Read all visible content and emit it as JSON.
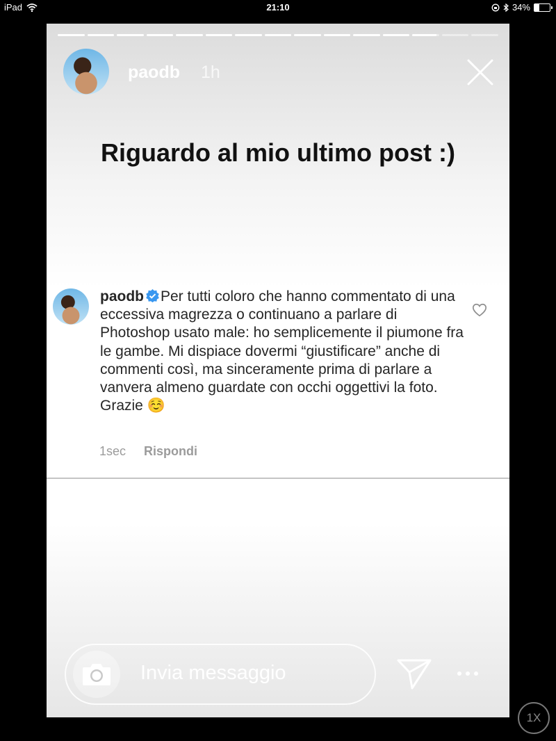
{
  "status_bar": {
    "device": "iPad",
    "time": "21:10",
    "battery_percent": "34%",
    "battery_level": 0.34
  },
  "story": {
    "segments_total": 15,
    "segments_complete": 12,
    "current_segment_progress": 0.9,
    "user": "paodb",
    "time_ago": "1h",
    "headline": "Riguardo al mio ultimo post :)"
  },
  "comment": {
    "user": "paodb",
    "text": "Per tutti coloro che hanno commentato di una eccessiva magrezza o continuano a parlare di Photoshop usato male: ho semplicemente il piumone fra le gambe. Mi dispiace dovermi “giustificare” anche di commenti così, ma sinceramente prima di parlare a vanvera almeno guardate con occhi oggettivi la foto.  Grazie ☺️",
    "time": "1sec",
    "reply_label": "Rispondi"
  },
  "composer": {
    "placeholder": "Invia messaggio"
  },
  "speed_label": "1X",
  "icons": [
    "wifi-icon",
    "camera-icon",
    "send-icon",
    "more-icon",
    "close-icon",
    "heart-icon",
    "verified-icon",
    "bluetooth-icon",
    "orientation-lock-icon"
  ]
}
